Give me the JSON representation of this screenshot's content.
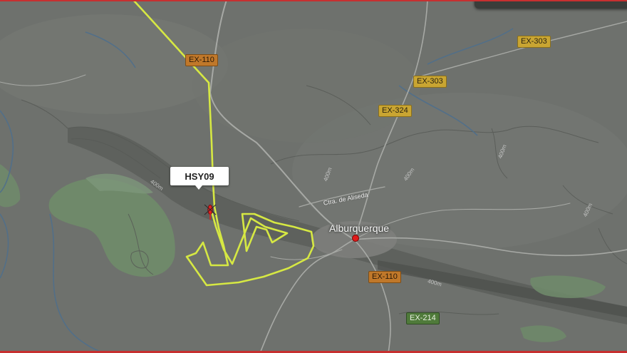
{
  "map": {
    "place_label": "Alburquerque",
    "street_label": "Ctra. de Aliseda",
    "flight_callsign": "HSY09",
    "road_labels": {
      "ex110_top": "EX-110",
      "ex303_right": "EX-303",
      "ex303_mid": "EX-303",
      "ex324": "EX-324",
      "ex110_bottom": "EX-110",
      "ex214": "EX-214"
    },
    "contour_labels": {
      "c1": "400m",
      "c2": "400m",
      "c3": "400m",
      "c4": "400m",
      "c5": "400m",
      "c6": "400m"
    },
    "colors": {
      "track": "#d6e843",
      "town_marker": "#e01b1b",
      "aircraft": "#e02020"
    },
    "icons": {
      "aircraft": "helicopter-icon",
      "town": "location-dot-icon"
    }
  }
}
